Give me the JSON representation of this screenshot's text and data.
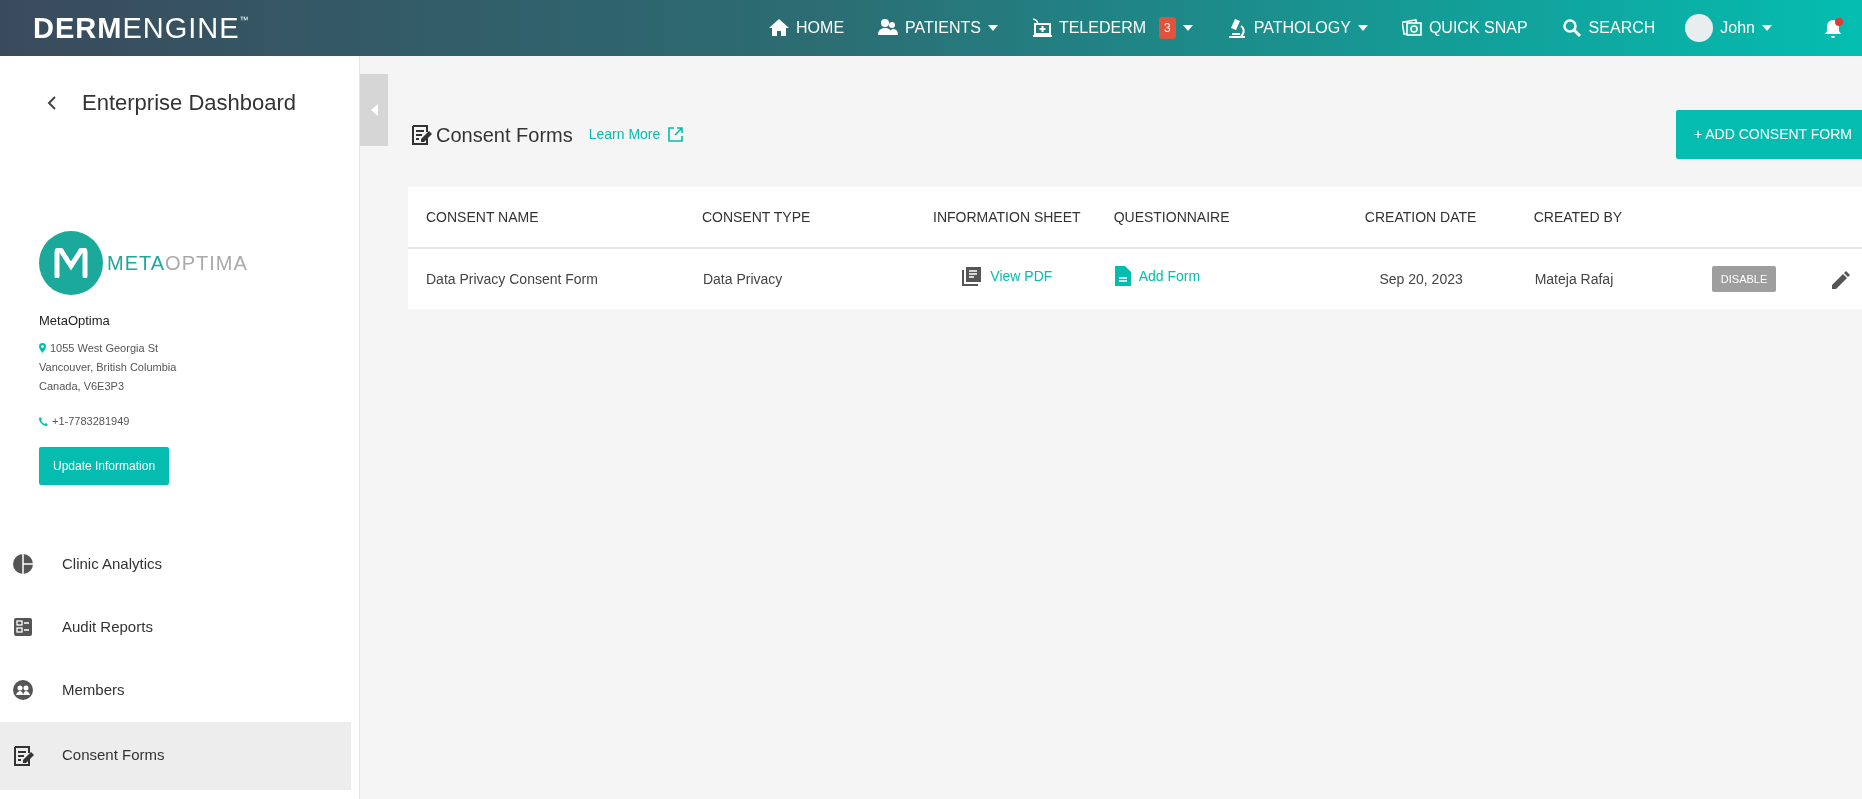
{
  "navbar": {
    "brand": "**DERM**ENGINE$^{™}$",
    "items": [
      {
        "label": "HOME",
        "kind": "home",
        "dropdown": false
      },
      {
        "label": "PATIENTS",
        "kind": "users",
        "dropdown": true
      },
      {
        "label": "TELEDERM",
        "kind": "telederm",
        "badge": "3",
        "dropdown": true
      },
      {
        "label": "PATHOLOGY",
        "kind": "microscope",
        "dropdown": true
      },
      {
        "label": "QUICK SNAP",
        "kind": "photos",
        "dropdown": false
      },
      {
        "label": "SEARCH",
        "kind": "search",
        "dropdown": false
      }
    ],
    "user": {
      "name": "John",
      "dropdown": true
    },
    "notifications": {
      "unread": true
    }
  },
  "sidebar": {
    "title": "Enterprise Dashboard",
    "organization": {
      "logo_parts": [
        "META",
        "OPTIMA"
      ],
      "name": "MetaOptima",
      "address": [
        "1055 West Georgia St",
        "Vancouver, British Columbia",
        "Canada, V6E3P3"
      ],
      "phone": "+1-7783281949",
      "button": "Update Information"
    },
    "items": [
      {
        "label": "Clinic Analytics",
        "kind": "pie",
        "selected": false
      },
      {
        "label": "Audit Reports",
        "kind": "report",
        "selected": false
      },
      {
        "label": "Members",
        "kind": "members",
        "selected": false
      },
      {
        "label": "Consent Forms",
        "kind": "form",
        "selected": true
      }
    ]
  },
  "main": {
    "title": "Consent Forms",
    "learn_more": "Learn More",
    "add_button": "+ ADD CONSENT FORM",
    "table": {
      "columns": [
        "CONSENT NAME",
        "CONSENT TYPE",
        "INFORMATION SHEET",
        "QUESTIONNAIRE",
        "CREATION DATE",
        "CREATED BY"
      ],
      "rows": [
        {
          "consent_name": "Data Privacy Consent Form",
          "consent_type": "Data Privacy",
          "information_sheet": "View PDF",
          "questionnaire": "Add Form",
          "creation_date": "Sep 20, 2023",
          "created_by": "Mateja Rafaj",
          "status_button": "DISABLE",
          "status_enabled": true
        }
      ]
    }
  }
}
